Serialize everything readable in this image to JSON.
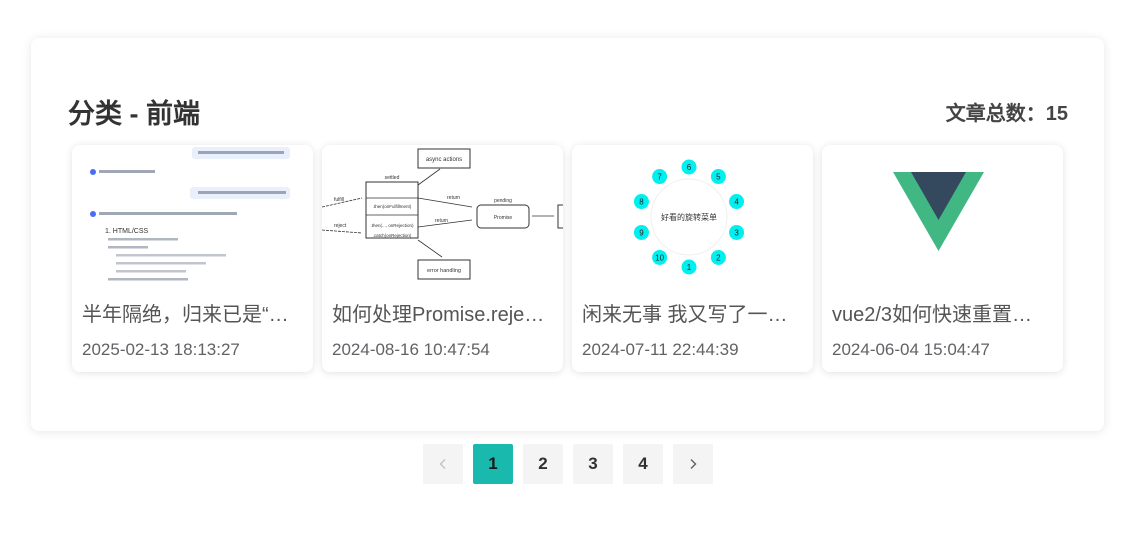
{
  "category": {
    "title": "分类 - 前端",
    "total_label": "文章总数：",
    "total_count": "15"
  },
  "articles": [
    {
      "title": "半年隔绝，归来已是“…",
      "date": "2025-02-13 18:13:27",
      "thumb_text": [
        "1. HTML/CSS"
      ]
    },
    {
      "title": "如何处理Promise.reje…",
      "date": "2024-08-16 10:47:54",
      "thumb_text": [
        "async actions",
        "settled",
        "fulfill",
        "reject",
        "pending",
        "return",
        "return",
        "Promise",
        ".then(onFulfillment)",
        ".then(..., onRejection)",
        ".catch(onRejection)",
        "error handling"
      ]
    },
    {
      "title": "闲来无事 我又写了一…",
      "date": "2024-07-11 22:44:39",
      "thumb_text": [
        "好看的旋转菜单"
      ],
      "thumb_numbers": [
        "1",
        "2",
        "3",
        "4",
        "5",
        "6",
        "7",
        "8",
        "9",
        "10"
      ]
    },
    {
      "title": "vue2/3如何快速重置…",
      "date": "2024-06-04 15:04:47",
      "thumb_text": []
    }
  ],
  "pagination": {
    "pages": [
      "1",
      "2",
      "3",
      "4"
    ],
    "current": "1",
    "prev_icon": "chevron-left-icon",
    "next_icon": "chevron-right-icon"
  },
  "colors": {
    "active_page": "#19b9ae",
    "menu_dot": "#00f0f0",
    "vue_green": "#41b883",
    "vue_dark": "#35495e"
  }
}
